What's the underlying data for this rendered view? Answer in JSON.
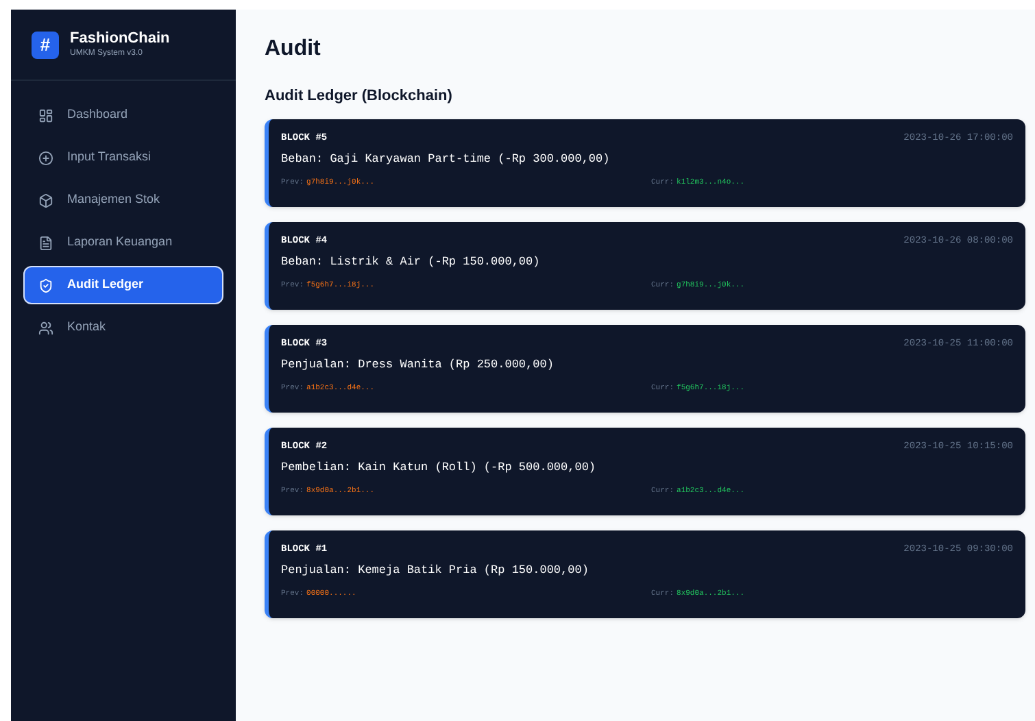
{
  "brand": {
    "logo": "#",
    "name": "FashionChain",
    "subtitle": "UMKM System v3.0"
  },
  "sidebar": {
    "items": [
      {
        "label": "Dashboard",
        "kind": "dashboard",
        "selected": false
      },
      {
        "label": "Input Transaksi",
        "kind": "input",
        "selected": false
      },
      {
        "label": "Manajemen Stok",
        "kind": "stock",
        "selected": false
      },
      {
        "label": "Laporan Keuangan",
        "kind": "report",
        "selected": false
      },
      {
        "label": "Audit Ledger",
        "kind": "audit",
        "selected": true
      },
      {
        "label": "Kontak",
        "kind": "contact",
        "selected": false
      }
    ]
  },
  "page_title": "Audit",
  "section_title": "Audit Ledger (Blockchain)",
  "blocks": [
    {
      "label": "BLOCK #5",
      "timestamp": "2023-10-26 17:00:00",
      "description": "Beban: Gaji Karyawan Part-time (-Rp 300.000,00)",
      "prev_label": "Prev:",
      "prev": "g7h8i9...j0k...",
      "curr_label": "Curr:",
      "curr": "k1l2m3...n4o..."
    },
    {
      "label": "BLOCK #4",
      "timestamp": "2023-10-26 08:00:00",
      "description": "Beban: Listrik & Air (-Rp 150.000,00)",
      "prev_label": "Prev:",
      "prev": "f5g6h7...i8j...",
      "curr_label": "Curr:",
      "curr": "g7h8i9...j0k..."
    },
    {
      "label": "BLOCK #3",
      "timestamp": "2023-10-25 11:00:00",
      "description": "Penjualan: Dress Wanita (Rp 250.000,00)",
      "prev_label": "Prev:",
      "prev": "a1b2c3...d4e...",
      "curr_label": "Curr:",
      "curr": "f5g6h7...i8j..."
    },
    {
      "label": "BLOCK #2",
      "timestamp": "2023-10-25 10:15:00",
      "description": "Pembelian: Kain Katun (Roll) (-Rp 500.000,00)",
      "prev_label": "Prev:",
      "prev": "8x9d0a...2b1...",
      "curr_label": "Curr:",
      "curr": "a1b2c3...d4e..."
    },
    {
      "label": "BLOCK #1",
      "timestamp": "2023-10-25 09:30:00",
      "description": "Penjualan: Kemeja Batik Pria (Rp 150.000,00)",
      "prev_label": "Prev:",
      "prev": "00000......",
      "curr_label": "Curr:",
      "curr": "8x9d0a...2b1..."
    }
  ]
}
